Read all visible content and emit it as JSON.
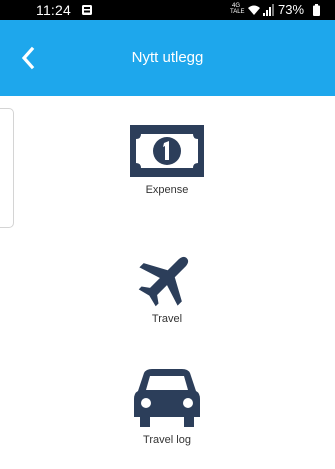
{
  "status_bar": {
    "time": "11:24",
    "network_top": "4G",
    "network_bottom": "TALE",
    "battery": "73%",
    "icons": [
      "notification-icon",
      "wifi-icon",
      "signal-icon",
      "battery-icon"
    ]
  },
  "header": {
    "title": "Nytt utlegg",
    "back_icon": "chevron-left-icon",
    "background_color": "#1ea7ec"
  },
  "options": [
    {
      "label": "Expense",
      "icon": "banknote-icon"
    },
    {
      "label": "Travel",
      "icon": "airplane-icon"
    },
    {
      "label": "Travel log",
      "icon": "car-icon"
    }
  ],
  "colors": {
    "accent": "#1ea7ec",
    "icon": "#2c3e5a",
    "label": "#333333"
  }
}
